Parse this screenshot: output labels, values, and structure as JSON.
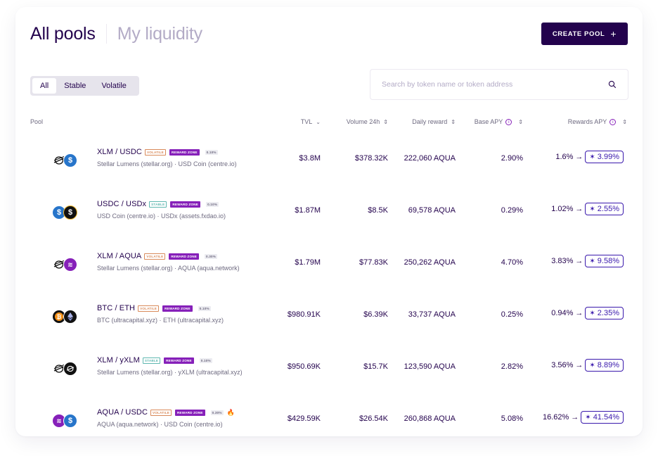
{
  "header": {
    "tab_all_pools": "All pools",
    "tab_my_liquidity": "My liquidity",
    "create_pool_label": "CREATE POOL",
    "create_pool_plus": "+"
  },
  "filters": {
    "all": "All",
    "stable": "Stable",
    "volatile": "Volatile",
    "selected": "All"
  },
  "search": {
    "placeholder": "Search by token name or token address",
    "value": ""
  },
  "columns": {
    "pool": "Pool",
    "tvl": "TVL",
    "volume": "Volume 24h",
    "daily_reward": "Daily reward",
    "base_apy": "Base APY",
    "rewards_apy": "Rewards APY"
  },
  "rows": [
    {
      "pair": "XLM / USDC",
      "type_badge": "VOLATILE",
      "reward_badge": "REWARD ZONE",
      "fee": "0.10%",
      "sub": "Stellar Lumens (stellar.org) · USD Coin (centre.io)",
      "tvl": "$3.8M",
      "volume": "$378.32K",
      "daily_reward": "222,060 AQUA",
      "base_apy": "2.90%",
      "rewards_apy": "1.6%",
      "arrow": "→",
      "boosted_apy": "3.99%"
    },
    {
      "pair": "USDC / USDx",
      "type_badge": "STABLE",
      "reward_badge": "REWARD ZONE",
      "fee": "0.10%",
      "sub": "USD Coin (centre.io) · USDx (assets.fxdao.io)",
      "tvl": "$1.87M",
      "volume": "$8.5K",
      "daily_reward": "69,578 AQUA",
      "base_apy": "0.29%",
      "rewards_apy": "1.02%",
      "arrow": "→",
      "boosted_apy": "2.55%"
    },
    {
      "pair": "XLM / AQUA",
      "type_badge": "VOLATILE",
      "reward_badge": "REWARD ZONE",
      "fee": "0.30%",
      "sub": "Stellar Lumens (stellar.org) · AQUA (aqua.network)",
      "tvl": "$1.79M",
      "volume": "$77.83K",
      "daily_reward": "250,262 AQUA",
      "base_apy": "4.70%",
      "rewards_apy": "3.83%",
      "arrow": "→",
      "boosted_apy": "9.58%"
    },
    {
      "pair": "BTC / ETH",
      "type_badge": "VOLATILE",
      "reward_badge": "REWARD ZONE",
      "fee": "0.10%",
      "sub": "BTC (ultracapital.xyz) · ETH (ultracapital.xyz)",
      "tvl": "$980.91K",
      "volume": "$6.39K",
      "daily_reward": "33,737 AQUA",
      "base_apy": "0.25%",
      "rewards_apy": "0.94%",
      "arrow": "→",
      "boosted_apy": "2.35%"
    },
    {
      "pair": "XLM / yXLM",
      "type_badge": "STABLE",
      "reward_badge": "REWARD ZONE",
      "fee": "0.10%",
      "sub": "Stellar Lumens (stellar.org) · yXLM (ultracapital.xyz)",
      "tvl": "$950.69K",
      "volume": "$15.7K",
      "daily_reward": "123,590 AQUA",
      "base_apy": "2.82%",
      "rewards_apy": "3.56%",
      "arrow": "→",
      "boosted_apy": "8.89%"
    },
    {
      "pair": "AQUA / USDC",
      "type_badge": "VOLATILE",
      "reward_badge": "REWARD ZONE",
      "fee": "0.30%",
      "sub": "AQUA (aqua.network) · USD Coin (centre.io)",
      "tvl": "$429.59K",
      "volume": "$26.54K",
      "daily_reward": "260,868 AQUA",
      "base_apy": "5.08%",
      "rewards_apy": "16.62%",
      "arrow": "→",
      "boosted_apy": "41.54%"
    }
  ],
  "icons": {
    "search": "search-icon",
    "sort": "sort-icon",
    "info": "info-icon",
    "boost": "boost-icon",
    "fire": "fire-icon"
  },
  "colors": {
    "primary": "#23024d",
    "accent_purple": "#8620b9",
    "boost_blue": "#3918ac",
    "muted": "#b3abc6"
  }
}
